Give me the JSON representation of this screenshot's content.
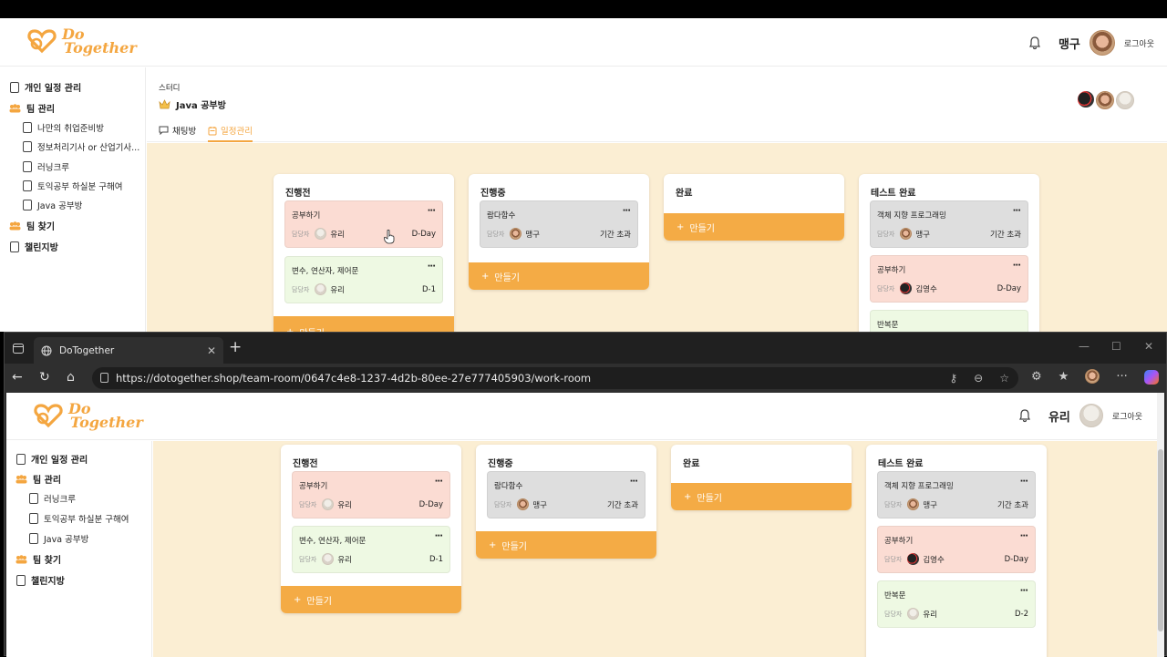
{
  "brand": {
    "logo_line1": "Do",
    "logo_line2": "Together",
    "accent": "#f4ab45"
  },
  "top_app": {
    "user_name": "맹구",
    "logout_label": "로그아웃",
    "sidebar": [
      {
        "label": "개인 일정 관리",
        "icon": "doc-icon"
      },
      {
        "label": "팀 관리",
        "icon": "team-icon"
      },
      {
        "label": "나만의 취업준비방",
        "icon": "doc-icon",
        "sub": true
      },
      {
        "label": "정보처리기사 or 산업기사...",
        "icon": "doc-icon",
        "sub": true
      },
      {
        "label": "러닝크루",
        "icon": "doc-icon",
        "sub": true
      },
      {
        "label": "토익공부 하실분 구해여",
        "icon": "doc-icon",
        "sub": true
      },
      {
        "label": "Java 공부방",
        "icon": "doc-icon",
        "sub": true
      },
      {
        "label": "팀 찾기",
        "icon": "team-icon"
      },
      {
        "label": "챌린지방",
        "icon": "doc-icon"
      }
    ],
    "room_category": "스터디",
    "room_name": "Java 공부방",
    "tabs": [
      "채팅방",
      "일정관리"
    ],
    "active_tab": "일정관리"
  },
  "browser": {
    "tab_title": "DoTogether",
    "url": "https://dotogether.shop/team-room/0647c4e8-1237-4d2b-80ee-27e777405903/work-room"
  },
  "bottom_app": {
    "user_name": "유리",
    "logout_label": "로그아웃",
    "sidebar": [
      {
        "label": "개인 일정 관리",
        "icon": "doc-icon"
      },
      {
        "label": "팀 관리",
        "icon": "team-icon"
      },
      {
        "label": "러닝크루",
        "icon": "doc-icon",
        "sub": true
      },
      {
        "label": "토익공부 하실분 구해여",
        "icon": "doc-icon",
        "sub": true
      },
      {
        "label": "Java 공부방",
        "icon": "doc-icon",
        "sub": true
      },
      {
        "label": "팀 찾기",
        "icon": "team-icon"
      },
      {
        "label": "챌린지방",
        "icon": "doc-icon"
      }
    ]
  },
  "board": {
    "owner_label": "담당자",
    "add_label": "만들기",
    "columns": [
      {
        "title": "진행전",
        "cards": [
          {
            "title": "공부하기",
            "owner": "유리",
            "due": "D-Day",
            "color": "red",
            "avatar": "bunny"
          },
          {
            "title": "변수, 연산자, 제어문",
            "owner": "유리",
            "due": "D-1",
            "color": "green",
            "avatar": "bunny"
          }
        ]
      },
      {
        "title": "진행중",
        "cards": [
          {
            "title": "람다함수",
            "owner": "맹구",
            "due": "기간 초과",
            "color": "gray",
            "avatar": "face"
          }
        ]
      },
      {
        "title": "완료",
        "cards": []
      },
      {
        "title": "테스트 완료",
        "cards": [
          {
            "title": "객체 지향 프로그래밍",
            "owner": "맹구",
            "due": "기간 초과",
            "color": "gray",
            "avatar": "face"
          },
          {
            "title": "공부하기",
            "owner": "김영수",
            "due": "D-Day",
            "color": "red",
            "avatar": "bird"
          },
          {
            "title": "반복문",
            "owner": "유리",
            "due": "D-2",
            "color": "green",
            "avatar": "bunny"
          }
        ]
      }
    ]
  }
}
